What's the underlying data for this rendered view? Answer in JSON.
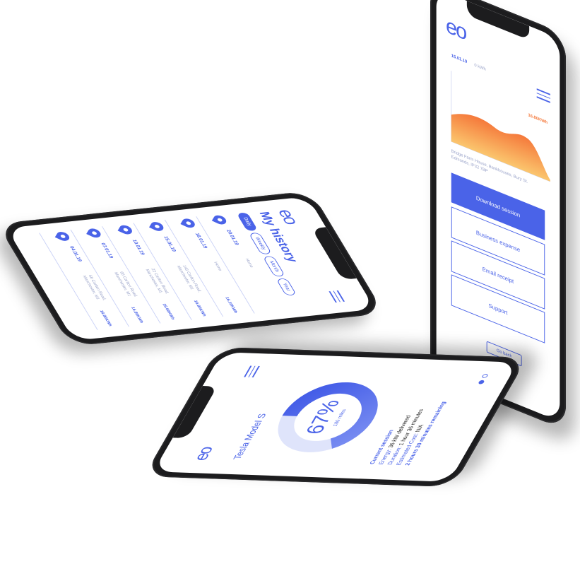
{
  "brand": {
    "logo_text": "eo",
    "accent": "#4a63e8",
    "chart_orange": "#f5a24b"
  },
  "history": {
    "title": "My history",
    "filters": [
      "Daily",
      "Weekly",
      "Month",
      "Year"
    ],
    "active_filter": "Daily",
    "rows": [
      {
        "date": "20.01.19",
        "address": "Home",
        "amount": ""
      },
      {
        "date": "18.01.19",
        "address": "Home",
        "amount": "16.10KWh"
      },
      {
        "date": "15.01.19",
        "address": "145 Carlton Road, Manchester, M1",
        "amount": "16.80KWh"
      },
      {
        "date": "10.01.19",
        "address": "22 Carlton Road, Manchester, M1",
        "amount": "16.60KWh"
      },
      {
        "date": "07.01.19",
        "address": "66 Carlton Road, Manchester, M1",
        "amount": "16.80KWh"
      },
      {
        "date": "04.01.19",
        "address": "66 Carlton Road, Manchester, M1",
        "amount": "16.80KWh"
      }
    ]
  },
  "detail": {
    "tab_active": "15.01.19",
    "tab_other": "0 kWh",
    "chart_badge": "16.80KWh",
    "address": "Bridge Farm House, Bankhouses, Bury St. Edmunds, IP32 7BP",
    "buttons": {
      "download": "Download session",
      "business": "Business expense",
      "email": "Email receipt",
      "support": "Support"
    },
    "back": "Go back"
  },
  "session": {
    "car": "Tesla Model S",
    "percent": "67%",
    "miles": "180 miles",
    "charge_fraction": 0.67,
    "heading": "Current session",
    "energy_label": "Energy:",
    "energy_value": "36 kW delivered",
    "duration_label": "Duration:",
    "duration_value": "1 hour 36 minutes",
    "cost_label": "Estimated Cost:",
    "cost_value": "N/A",
    "remaining": "2 hours 30 minutes remaining"
  }
}
